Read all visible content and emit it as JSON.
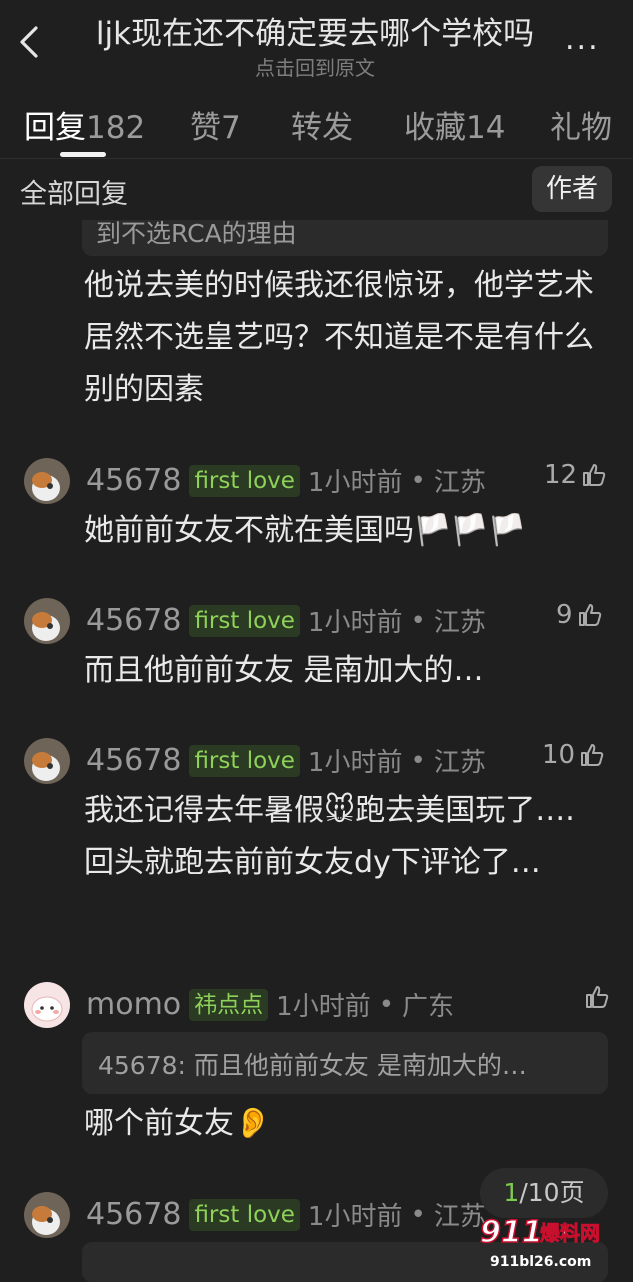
{
  "header": {
    "title": "ljk现在还不确定要去哪个学校吗",
    "subtitle": "点击回到原文",
    "more": "..."
  },
  "tabs": [
    {
      "name": "回复",
      "count": "182"
    },
    {
      "name": "赞",
      "count": "7"
    },
    {
      "name": "转发",
      "count": ""
    },
    {
      "name": "收藏",
      "count": "14"
    },
    {
      "name": "礼物",
      "count": ""
    }
  ],
  "filter": {
    "all_replies": "全部回复",
    "author_button": "作者"
  },
  "top_quote": "到不选RCA的理由",
  "top_body": "他说去美的时候我还很惊讶，他学艺术居然不选皇艺吗？不知道是不是有什么别的因素",
  "comments": [
    {
      "user": "45678",
      "badge": "first love",
      "time": "1小时前",
      "location": "江苏",
      "likes": "12",
      "text": "她前前女友不就在美国吗🏳️🏳️🏳️"
    },
    {
      "user": "45678",
      "badge": "first love",
      "time": "1小时前",
      "location": "江苏",
      "likes": "9",
      "text": "而且他前前女友 是南加大的…"
    },
    {
      "user": "45678",
      "badge": "first love",
      "time": "1小时前",
      "location": "江苏",
      "likes": "10",
      "text": "我还记得去年暑假🐭跑去美国玩了….回头就跑去前前女友dy下评论了…"
    },
    {
      "user": "momo",
      "badge": "祎点点",
      "time": "1小时前",
      "location": "广东",
      "likes": "",
      "quote": "45678: 而且他前前女友 是南加大的…",
      "text": "哪个前女友👂"
    },
    {
      "user": "45678",
      "badge": "first love",
      "time": "1小时前",
      "location": "江苏",
      "likes": "",
      "text": ""
    }
  ],
  "pager": {
    "current": "1",
    "total": "/10页"
  },
  "watermark": {
    "brand": "911爆料网",
    "domain": "911bl26.com"
  },
  "colors": {
    "background": "#1f1f1f",
    "badge_green": "#8ed25a"
  }
}
